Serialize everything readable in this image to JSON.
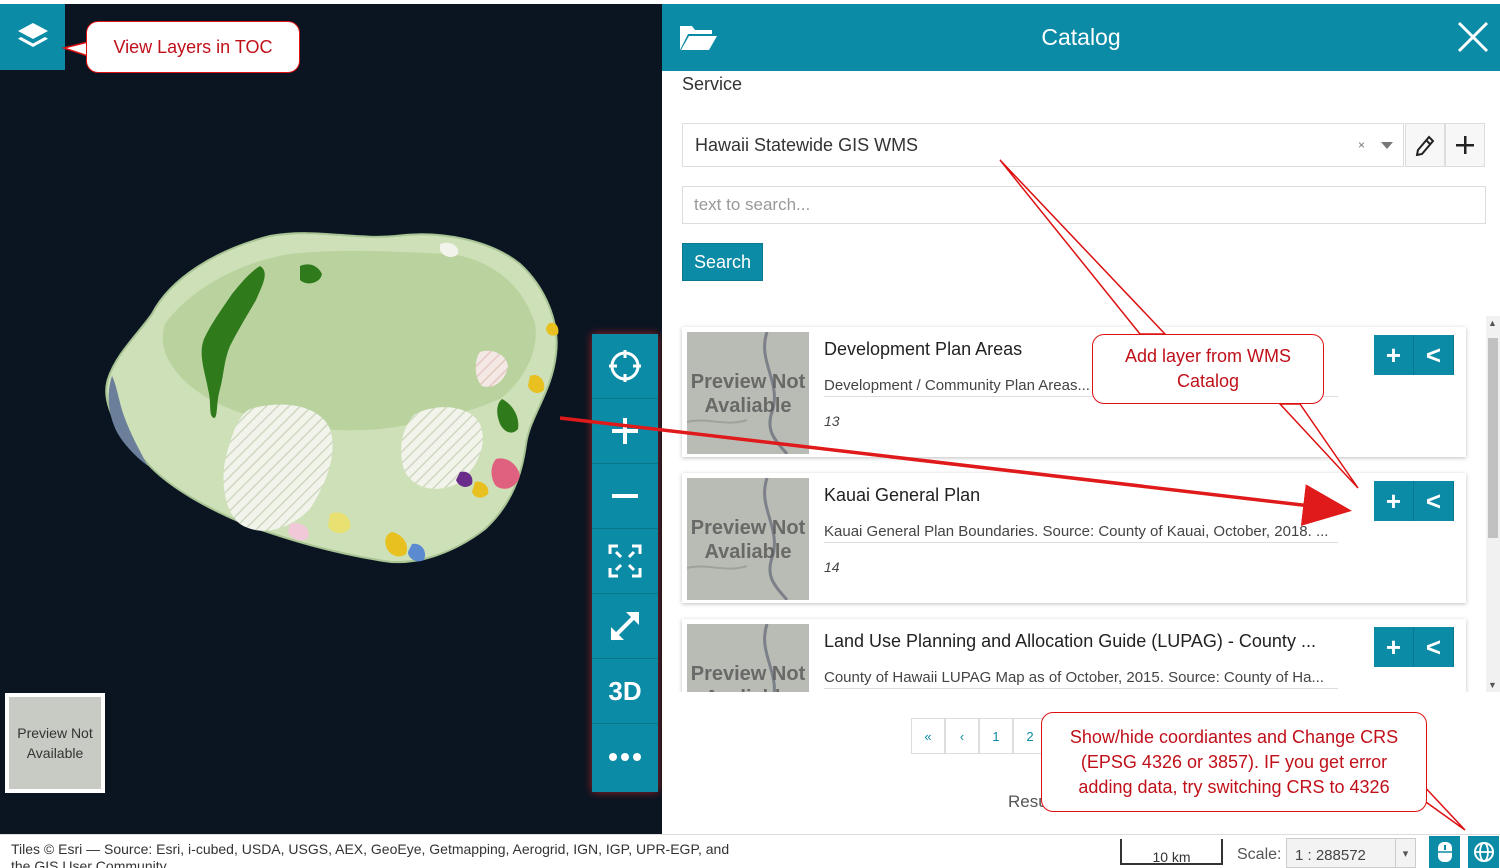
{
  "catalog": {
    "title": "Catalog",
    "service_label": "Service",
    "service_selected": "Hawaii Statewide GIS WMS",
    "service_clear": "×",
    "search_placeholder": "text to search...",
    "search_button": "Search",
    "records": [
      {
        "title": "Development Plan Areas",
        "description": "Development / Community Plan Areas...",
        "id": "13",
        "preview": "Preview Not Avaliable"
      },
      {
        "title": "Kauai General Plan",
        "description": "Kauai General Plan Boundaries. Source: County of Kauai, October, 2018. ...",
        "id": "14",
        "preview": "Preview Not Avaliable"
      },
      {
        "title": "Land Use Planning and Allocation Guide (LUPAG) - County ...",
        "description": "County of Hawaii LUPAG Map as of October, 2015. Source: County of Ha...",
        "id": "",
        "preview": "Preview Not Avaliable"
      }
    ],
    "pagination": [
      "«",
      "‹",
      "1",
      "2"
    ],
    "results_text": "Resu"
  },
  "map": {
    "toolbar": [
      "locate-icon",
      "zoom-in-icon",
      "zoom-out-icon",
      "zoom-extent-icon",
      "fullscreen-icon",
      "3D",
      "more-icon"
    ],
    "label_3d": "3D",
    "background_preview": "Preview Not Available"
  },
  "footer": {
    "attribution": "Tiles © Esri — Source: Esri, i-cubed, USDA, USGS, AEX, GeoEye, Getmapping, Aerogrid, IGN, IGP, UPR-EGP, and the GIS User Community",
    "scalebar": "10 km",
    "scale_label": "Scale:",
    "scale_value": "1 : 288572"
  },
  "annotations": {
    "toc": "View Layers in TOC",
    "wms_line1": "Add layer from WMS",
    "wms_line2": "Catalog",
    "crs_line1": "Show/hide coordiantes and Change CRS",
    "crs_line2": "(EPSG 4326 or 3857). IF you get error",
    "crs_line3": "adding data, try switching CRS to 4326"
  },
  "colors": {
    "accent": "#0b8ba5",
    "annotation": "#d11111",
    "map_background": "#0b1522"
  }
}
